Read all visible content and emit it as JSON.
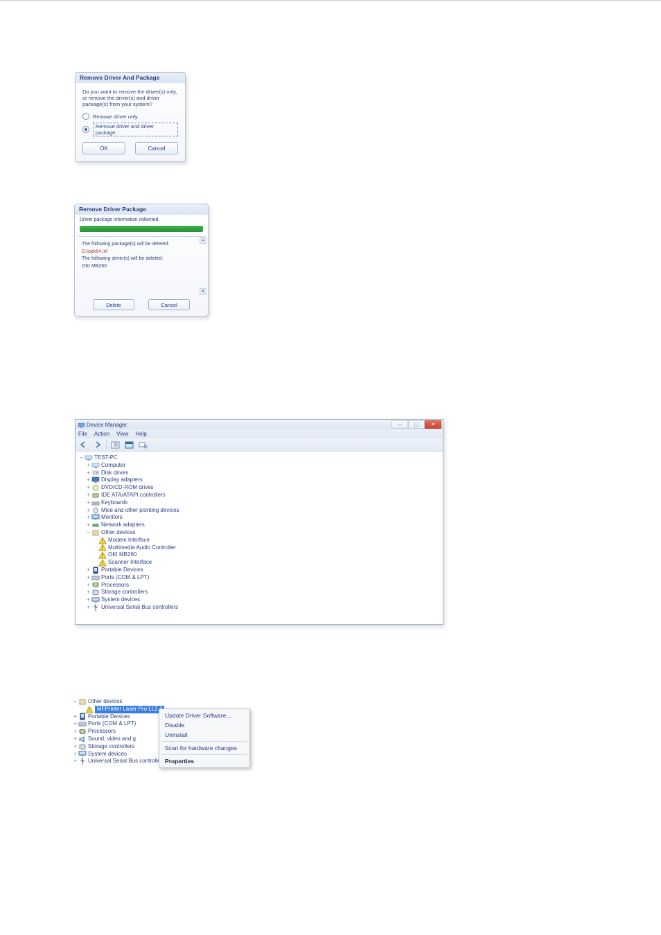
{
  "dialog1": {
    "title": "Remove Driver And Package",
    "message": "Do you want to remove the driver(s) only, or remove the driver(s) and driver package(s) from your system?",
    "option1": "Remove driver only.",
    "option2": "Remove driver and driver package.",
    "ok": "OK",
    "cancel": "Cancel"
  },
  "dialog2": {
    "title": "Remove Driver Package",
    "subhead": "Driver package information collected.",
    "line1": "The following package(s) will be deleted:",
    "line2": "D:\\opk64.inf",
    "line3": "The following driver(s) will be deleted:",
    "line4": "OKI MB260",
    "delete": "Delete",
    "cancel": "Cancel"
  },
  "devmgr": {
    "title": "Device Manager",
    "menu": {
      "file": "File",
      "action": "Action",
      "view": "View",
      "help": "Help"
    },
    "tree": [
      {
        "depth": 0,
        "toggle": "−",
        "icon": "computer",
        "label": "TEST-PC"
      },
      {
        "depth": 1,
        "toggle": "+",
        "icon": "computer",
        "label": "Computer"
      },
      {
        "depth": 1,
        "toggle": "+",
        "icon": "disk",
        "label": "Disk drives"
      },
      {
        "depth": 1,
        "toggle": "+",
        "icon": "display",
        "label": "Display adapters"
      },
      {
        "depth": 1,
        "toggle": "+",
        "icon": "dvd",
        "label": "DVD/CD-ROM drives"
      },
      {
        "depth": 1,
        "toggle": "+",
        "icon": "ide",
        "label": "IDE ATA/ATAPI controllers"
      },
      {
        "depth": 1,
        "toggle": "+",
        "icon": "keyboard",
        "label": "Keyboards"
      },
      {
        "depth": 1,
        "toggle": "+",
        "icon": "mouse",
        "label": "Mice and other pointing devices"
      },
      {
        "depth": 1,
        "toggle": "+",
        "icon": "monitor",
        "label": "Monitors"
      },
      {
        "depth": 1,
        "toggle": "+",
        "icon": "network",
        "label": "Network adapters"
      },
      {
        "depth": 1,
        "toggle": "−",
        "icon": "other",
        "label": "Other devices"
      },
      {
        "depth": 2,
        "toggle": "",
        "icon": "warn",
        "label": "Modem Interface"
      },
      {
        "depth": 2,
        "toggle": "",
        "icon": "warn",
        "label": "Multimedia Audio Controller"
      },
      {
        "depth": 2,
        "toggle": "",
        "icon": "warn",
        "label": "OKI MB260"
      },
      {
        "depth": 2,
        "toggle": "",
        "icon": "warn",
        "label": "Scanner Interface"
      },
      {
        "depth": 1,
        "toggle": "+",
        "icon": "portable",
        "label": "Portable Devices"
      },
      {
        "depth": 1,
        "toggle": "+",
        "icon": "port",
        "label": "Ports (COM & LPT)"
      },
      {
        "depth": 1,
        "toggle": "+",
        "icon": "cpu",
        "label": "Processors"
      },
      {
        "depth": 1,
        "toggle": "+",
        "icon": "storage",
        "label": "Storage controllers"
      },
      {
        "depth": 1,
        "toggle": "+",
        "icon": "system",
        "label": "System devices"
      },
      {
        "depth": 1,
        "toggle": "+",
        "icon": "usb",
        "label": "Universal Serial Bus controllers"
      }
    ]
  },
  "snippet4": {
    "tree": [
      {
        "depth": 0,
        "toggle": "−",
        "icon": "other",
        "label": "Other devices"
      },
      {
        "depth": 1,
        "toggle": "",
        "icon": "warn",
        "label": "MFPrinter Laser Pro LL2 4",
        "selected": true
      },
      {
        "depth": 0,
        "toggle": "+",
        "icon": "portable",
        "label": "Portable Devices"
      },
      {
        "depth": 0,
        "toggle": "+",
        "icon": "port",
        "label": "Ports (COM & LPT)"
      },
      {
        "depth": 0,
        "toggle": "+",
        "icon": "cpu",
        "label": "Processors"
      },
      {
        "depth": 0,
        "toggle": "+",
        "icon": "sound",
        "label": "Sound, video and g"
      },
      {
        "depth": 0,
        "toggle": "+",
        "icon": "storage",
        "label": "Storage controllers"
      },
      {
        "depth": 0,
        "toggle": "+",
        "icon": "system",
        "label": "System devices"
      },
      {
        "depth": 0,
        "toggle": "+",
        "icon": "usb",
        "label": "Universal Serial Bus controllers"
      }
    ],
    "menu": {
      "update": "Update Driver Software...",
      "disable": "Disable",
      "uninstall": "Uninstall",
      "scan": "Scan for hardware changes",
      "properties": "Properties"
    }
  }
}
